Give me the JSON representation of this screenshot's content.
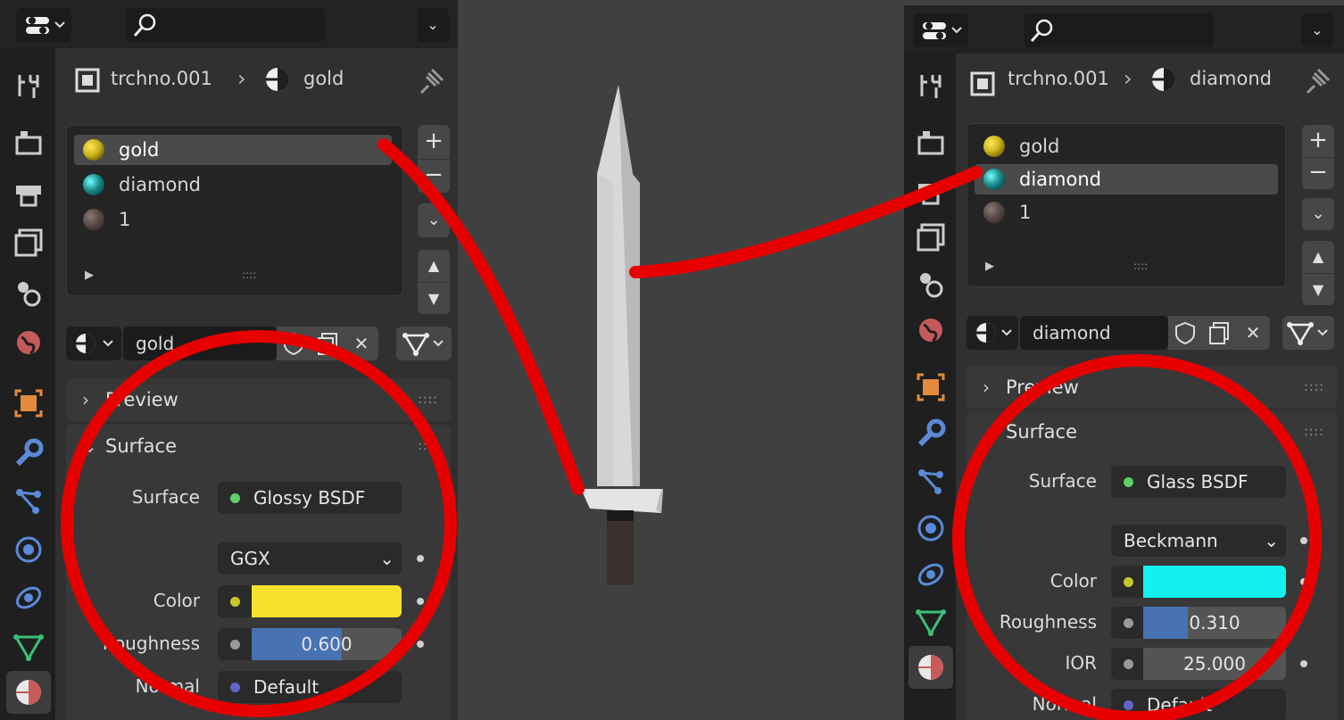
{
  "left": {
    "breadcrumb": {
      "object": "trchno.001",
      "material": "gold"
    },
    "slots": [
      {
        "name": "gold",
        "color": "#c9b21a",
        "selected": true
      },
      {
        "name": "diamond",
        "color": "#1b8d8d",
        "selected": false
      },
      {
        "name": "1",
        "color": "#5a4a46",
        "selected": false
      }
    ],
    "material_name": "gold",
    "preview_label": "Preview",
    "surface_label": "Surface",
    "props": {
      "surface_label": "Surface",
      "surface_value": "Glossy BSDF",
      "distribution": "GGX",
      "color_label": "Color",
      "color_value": "#f7e02c",
      "roughness_label": "Roughness",
      "roughness_value": "0.600",
      "roughness_fraction": 0.6,
      "normal_label": "Normal",
      "normal_value": "Default"
    }
  },
  "right": {
    "breadcrumb": {
      "object": "trchno.001",
      "material": "diamond"
    },
    "slots": [
      {
        "name": "gold",
        "color": "#c9b21a",
        "selected": false
      },
      {
        "name": "diamond",
        "color": "#1b8d8d",
        "selected": true
      },
      {
        "name": "1",
        "color": "#5a4a46",
        "selected": false
      }
    ],
    "material_name": "diamond",
    "preview_label": "Preview",
    "surface_label": "Surface",
    "props": {
      "surface_label": "Surface",
      "surface_value": "Glass BSDF",
      "distribution": "Beckmann",
      "color_label": "Color",
      "color_value": "#13f0f0",
      "roughness_label": "Roughness",
      "roughness_value": "0.310",
      "roughness_fraction": 0.31,
      "ior_label": "IOR",
      "ior_value": "25.000",
      "normal_label": "Normal",
      "normal_value": "Default"
    }
  },
  "colors": {
    "accent_blue": "#4772b3",
    "annotation_red": "#e60000",
    "surface_socket": "#5ecf6a",
    "color_socket": "#c7c729",
    "vector_socket": "#6363c7"
  },
  "icons": [
    "editor-type-icon",
    "search-icon",
    "chevron-down-icon",
    "tool-icon",
    "render-icon",
    "output-icon",
    "view-layer-icon",
    "scene-icon",
    "world-icon",
    "object-icon",
    "modifier-icon",
    "particles-icon",
    "physics-icon",
    "constraints-icon",
    "data-icon",
    "material-icon",
    "pin-icon",
    "add-icon",
    "remove-icon",
    "move-up-icon",
    "move-down-icon",
    "fake-user-icon",
    "duplicate-icon",
    "unlink-icon",
    "link-mode-icon"
  ]
}
